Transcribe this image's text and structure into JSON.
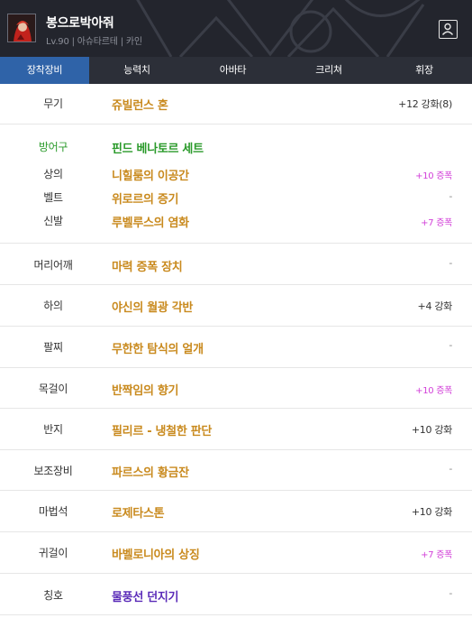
{
  "header": {
    "name": "봉으로박아줘",
    "info": "Lv.90 | 아슈타르테 | 카인"
  },
  "tabs": [
    {
      "label": "장착장비",
      "active": true
    },
    {
      "label": "능력치",
      "active": false
    },
    {
      "label": "아바타",
      "active": false
    },
    {
      "label": "크리쳐",
      "active": false
    },
    {
      "label": "휘장",
      "active": false
    }
  ],
  "rows": {
    "weapon": {
      "category": "무기",
      "item": "쥬빌런스 혼",
      "enhance": "+12 강화(8)"
    },
    "armor": {
      "category": "방어구",
      "set": "핀드 베나토르 세트",
      "items": [
        {
          "category": "상의",
          "item": "니힐룸의 이공간",
          "enhance": "+10 증폭"
        },
        {
          "category": "벨트",
          "item": "위로르의 증기",
          "enhance": "-"
        },
        {
          "category": "신발",
          "item": "루벨루스의 염화",
          "enhance": "+7 증폭"
        }
      ]
    },
    "shoulder": {
      "category": "머리어깨",
      "item": "마력 증폭 장치",
      "enhance": "-"
    },
    "pants": {
      "category": "하의",
      "item": "야신의 월광 각반",
      "enhance": "+4 강화"
    },
    "bracelet": {
      "category": "팔찌",
      "item": "무한한 탐식의 얼개",
      "enhance": "-"
    },
    "necklace": {
      "category": "목걸이",
      "item": "반짝임의 향기",
      "enhance": "+10 증폭"
    },
    "ring": {
      "category": "반지",
      "item": "필리르 - 냉철한 판단",
      "enhance": "+10 강화"
    },
    "support": {
      "category": "보조장비",
      "item": "파르스의 황금잔",
      "enhance": "-"
    },
    "magicstone": {
      "category": "마법석",
      "item": "로제타스톤",
      "enhance": "+10 강화"
    },
    "earring": {
      "category": "귀걸이",
      "item": "바벨로니아의 상징",
      "enhance": "+7 증폭"
    },
    "title": {
      "category": "칭호",
      "item": "물풍선 던지기",
      "enhance": "-"
    }
  },
  "colors": {
    "header_bg": "#23252d",
    "tab_bar": "#2c2f38",
    "tab_active": "#2f63a8",
    "item_orange": "#c98a1e",
    "set_green": "#2a9a2a",
    "growth_magenta": "#d23fd8",
    "title_purple": "#5a2bb8"
  },
  "icons": {
    "profile": "user-profile-icon",
    "avatar": "character-portrait"
  }
}
